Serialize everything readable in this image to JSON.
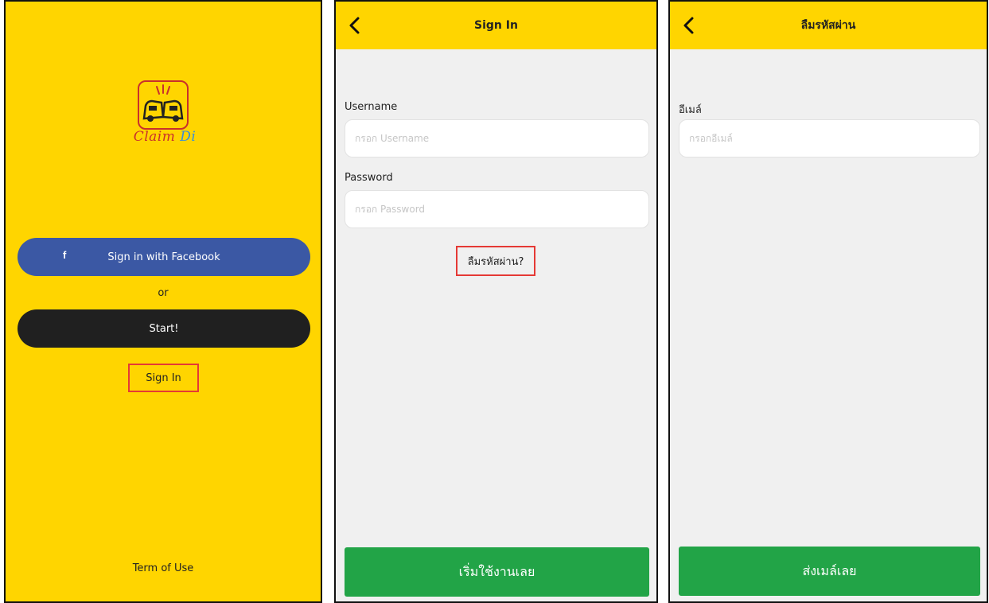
{
  "screen1": {
    "logo_word1": "Claim",
    "logo_word2": "Di",
    "facebook_icon": "f",
    "facebook_button_label": "Sign in with Facebook",
    "or_text": "or",
    "start_button_label": "Start!",
    "signin_link_label": "Sign In",
    "terms_link_label": "Term of Use"
  },
  "screen2": {
    "header_title": "Sign In",
    "username_label": "Username",
    "username_placeholder": "กรอก Username",
    "password_label": "Password",
    "password_placeholder": "กรอก Password",
    "forgot_password_label": "ลืมรหัสผ่าน?",
    "submit_button_label": "เริ่มใช้งานเลย"
  },
  "screen3": {
    "header_title": "ลืมรหัสผ่าน",
    "email_label": "อีเมล์",
    "email_placeholder": "กรอกอีเมล์",
    "submit_button_label": "ส่งเมล์เลย"
  },
  "icons": {
    "back": "chevron-left-icon",
    "facebook": "facebook-icon",
    "logo": "car-crash-logo-icon"
  },
  "colors": {
    "brand_yellow": "#FFD500",
    "facebook_blue": "#3b58a4",
    "start_black": "#202020",
    "action_green": "#22a447",
    "highlight_red": "#e53935"
  }
}
